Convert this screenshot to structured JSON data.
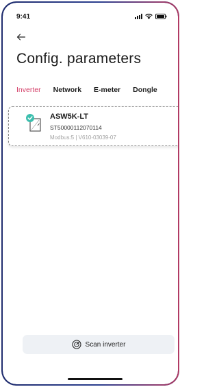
{
  "status_bar": {
    "time": "9:41"
  },
  "header": {
    "title": "Config. parameters"
  },
  "tabs": [
    {
      "label": "Inverter",
      "active": true
    },
    {
      "label": "Network",
      "active": false
    },
    {
      "label": "E-meter",
      "active": false
    },
    {
      "label": "Dongle",
      "active": false
    }
  ],
  "device": {
    "name": "ASW5K-LT",
    "serial": "ST50000112070114",
    "meta": "Modbus:5 | V610-03039-07",
    "status": "connected"
  },
  "actions": {
    "scan_label": "Scan inverter"
  },
  "colors": {
    "accent": "#d43f68",
    "frame": "#22306b",
    "check": "#3cbfae"
  }
}
